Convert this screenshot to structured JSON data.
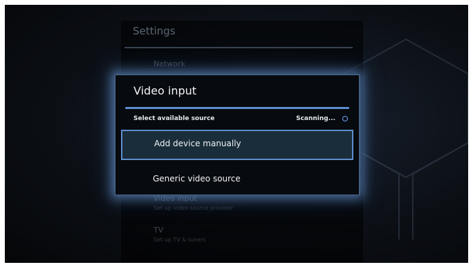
{
  "background_menu": {
    "title": "Settings",
    "items": [
      {
        "label": "Network",
        "sub": ""
      },
      {
        "label": "Video input",
        "sub": "Set up video source provider"
      },
      {
        "label": "TV",
        "sub": "Set up TV & tuners"
      }
    ]
  },
  "dialog": {
    "title": "Video input",
    "subtitle": "Select available source",
    "status": "Scanning...",
    "options": [
      {
        "label": "Add device manually",
        "selected": true
      },
      {
        "label": "Generic video source",
        "selected": false
      }
    ]
  },
  "colors": {
    "accent": "#5b8ed0",
    "selected_bg": "#1a2d3a",
    "glow": "#78aaeb"
  },
  "icons": {
    "status_spinner": "spinner-icon"
  }
}
